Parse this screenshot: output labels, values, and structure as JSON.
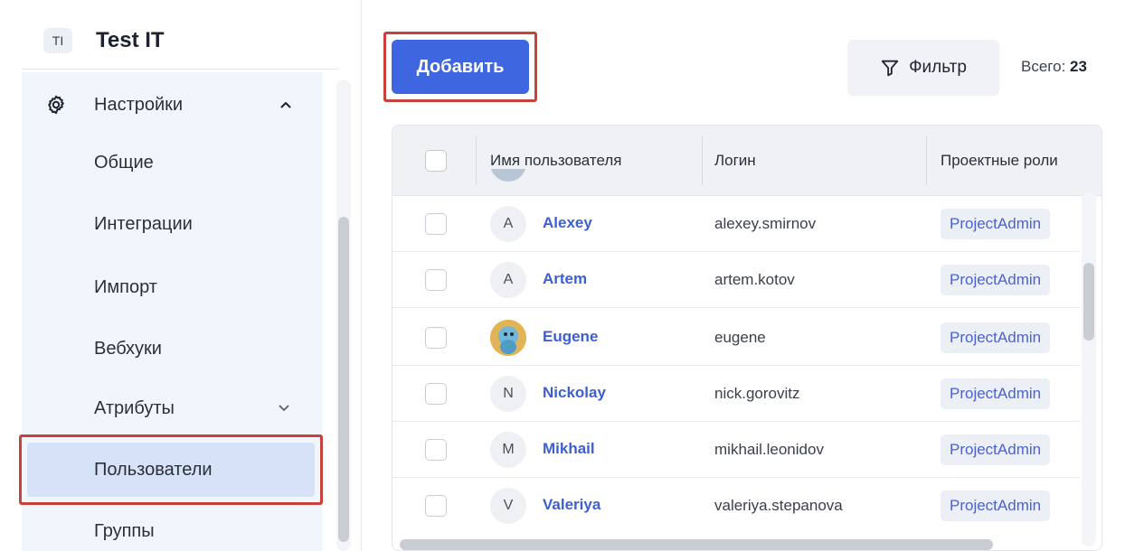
{
  "org": {
    "badge": "TI",
    "name": "Test IT"
  },
  "sidebar": {
    "settings_label": "Настройки",
    "items": [
      {
        "label": "Общие"
      },
      {
        "label": "Интеграции"
      },
      {
        "label": "Импорт"
      },
      {
        "label": "Вебхуки"
      },
      {
        "label": "Атрибуты"
      },
      {
        "label": "Пользователи"
      },
      {
        "label": "Группы"
      }
    ]
  },
  "toolbar": {
    "add_label": "Добавить",
    "filter_label": "Фильтр",
    "total_label": "Всего:",
    "total_count": "23"
  },
  "table": {
    "columns": [
      "Имя пользователя",
      "Логин",
      "Проектные роли"
    ],
    "rows": [
      {
        "avatar": "A",
        "name": "Alexey",
        "login": "alexey.smirnov",
        "role": "ProjectAdmin"
      },
      {
        "avatar": "A",
        "name": "Artem",
        "login": "artem.kotov",
        "role": "ProjectAdmin"
      },
      {
        "avatar": "",
        "name": "Eugene",
        "login": "eugene",
        "role": "ProjectAdmin"
      },
      {
        "avatar": "N",
        "name": "Nickolay",
        "login": "nick.gorovitz",
        "role": "ProjectAdmin"
      },
      {
        "avatar": "M",
        "name": "Mikhail",
        "login": "mikhail.leonidov",
        "role": "ProjectAdmin"
      },
      {
        "avatar": "V",
        "name": "Valeriya",
        "login": "valeriya.stepanova",
        "role": "ProjectAdmin"
      }
    ]
  },
  "colors": {
    "accent": "#3d66e0",
    "highlight": "#c8413b",
    "active_item": "#d6e2f8"
  }
}
